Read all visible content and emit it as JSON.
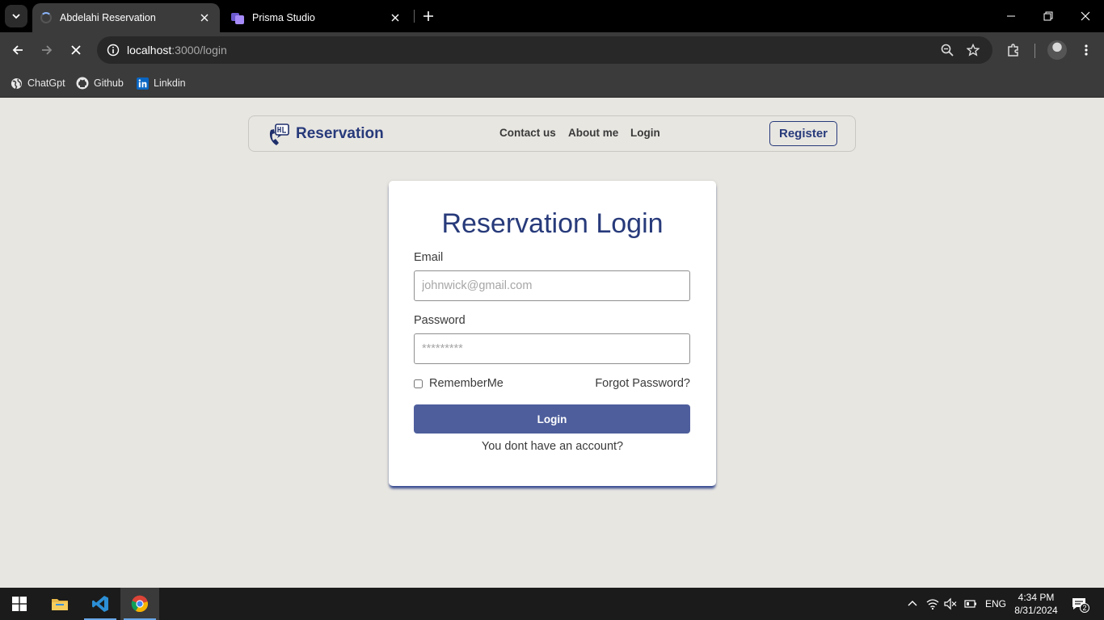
{
  "browser": {
    "tabs": [
      {
        "title": "Abdelahi Reservation",
        "active": true,
        "loading": true
      },
      {
        "title": "Prisma Studio",
        "active": false,
        "favicon": "prisma-icon"
      }
    ],
    "url_host": "localhost",
    "url_path": ":3000/login",
    "bookmarks": [
      {
        "label": "ChatGpt",
        "icon": "globe-icon"
      },
      {
        "label": "Github",
        "icon": "github-icon"
      },
      {
        "label": "Linkdin",
        "icon": "linkedin-icon"
      }
    ]
  },
  "navbar": {
    "brand": "Reservation",
    "links": [
      "Contact us",
      "About me",
      "Login"
    ],
    "register_label": "Register"
  },
  "login_form": {
    "title": "Reservation Login",
    "email_label": "Email",
    "email_placeholder": "johnwick@gmail.com",
    "password_label": "Password",
    "password_placeholder": "*********",
    "remember_label": "RememberMe",
    "forgot_label": "Forgot Password?",
    "submit_label": "Login",
    "no_account_text": "You dont have an account?"
  },
  "taskbar": {
    "language": "ENG",
    "time": "4:34 PM",
    "date": "8/31/2024",
    "notification_count": "2"
  },
  "colors": {
    "brand": "#273a7a",
    "button": "#4e5e9c",
    "page_bg": "#e8e6e1"
  }
}
